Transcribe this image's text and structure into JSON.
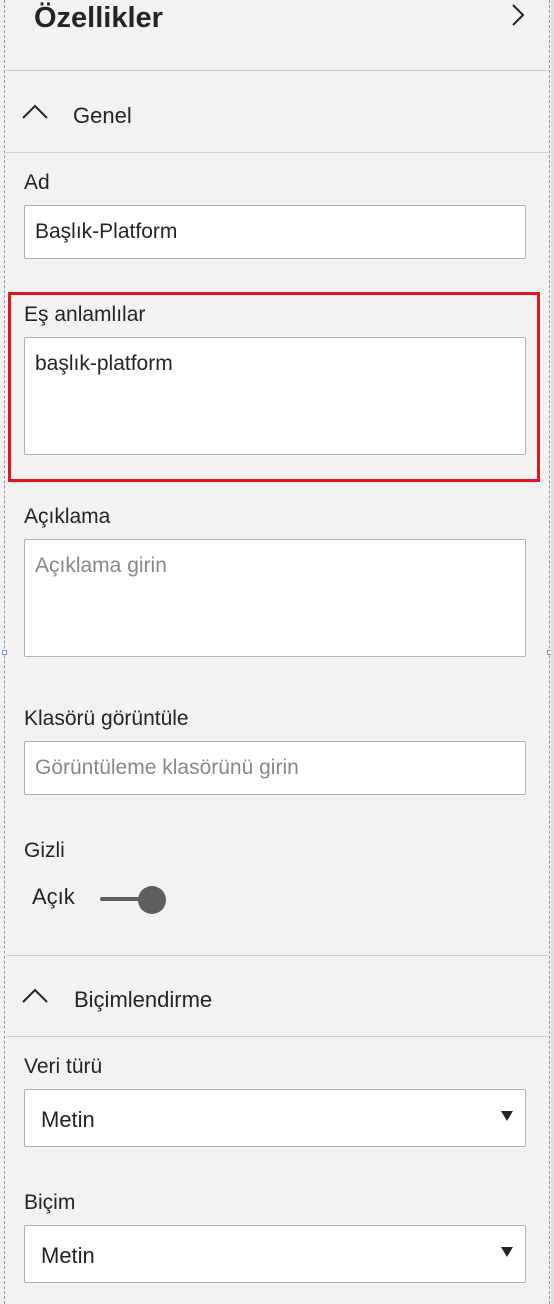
{
  "pane": {
    "title": "Özellikler"
  },
  "sections": {
    "general": {
      "label": "Genel",
      "expanded": true
    },
    "formatting": {
      "label": "Biçimlendirme",
      "expanded": true
    }
  },
  "fields": {
    "name": {
      "label": "Ad",
      "value": "Başlık-Platform"
    },
    "synonyms": {
      "label": "Eş anlamlılar",
      "value": "başlık-platform"
    },
    "description": {
      "label": "Açıklama",
      "placeholder": "Açıklama girin"
    },
    "display_folder": {
      "label": "Klasörü görüntüle",
      "placeholder": "Görüntüleme klasörünü girin"
    },
    "hidden": {
      "label": "Gizli",
      "state_label": "Açık",
      "on": true
    },
    "data_type": {
      "label": "Veri türü",
      "value": "Metin"
    },
    "format": {
      "label": "Biçim",
      "value": "Metin"
    }
  },
  "colors": {
    "highlight": "#e81123",
    "pane_background": "#f3f2f1",
    "toggle": "#605e5c"
  },
  "icons": {
    "pane_collapse": "chevron-right-icon",
    "section_toggle": "chevron-up-icon",
    "dropdown": "caret-down-icon"
  }
}
